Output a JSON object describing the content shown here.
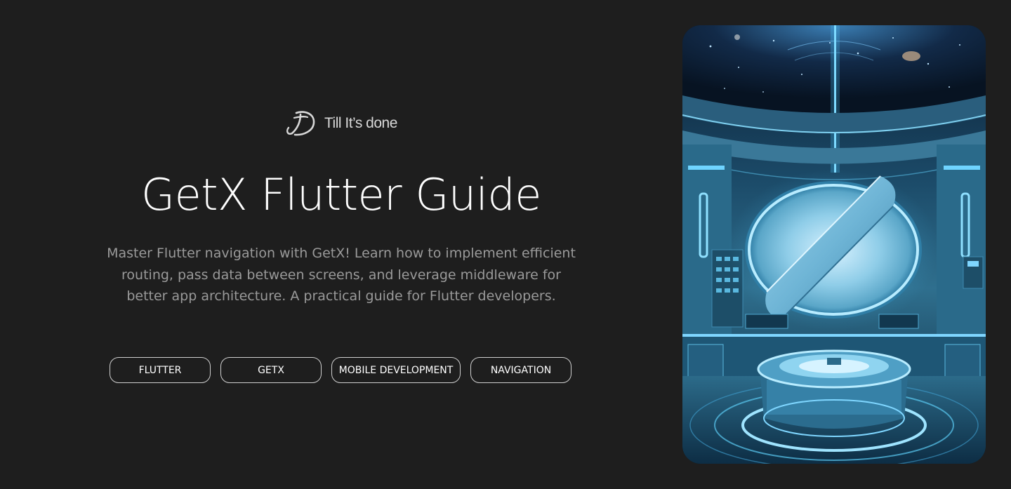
{
  "brand": {
    "name": "Till It’s done",
    "logo_icon": "signature-d-logo-icon"
  },
  "hero": {
    "title": "GetX Flutter Guide",
    "description": "Master Flutter navigation with GetX! Learn how to implement efficient routing, pass data between screens, and leverage middleware for better app architecture. A practical guide for Flutter developers."
  },
  "tags": [
    {
      "label": "FLUTTER"
    },
    {
      "label": "GETX"
    },
    {
      "label": "MOBILE DEVELOPMENT"
    },
    {
      "label": "NAVIGATION"
    }
  ],
  "image": {
    "subject": "futuristic-circular-lab-icon"
  },
  "colors": {
    "background": "#1e1e1e",
    "title": "#ffffff",
    "description": "#9a9a9a",
    "tag_border": "#cfcfcf",
    "accent_glow": "#49c6ff"
  }
}
